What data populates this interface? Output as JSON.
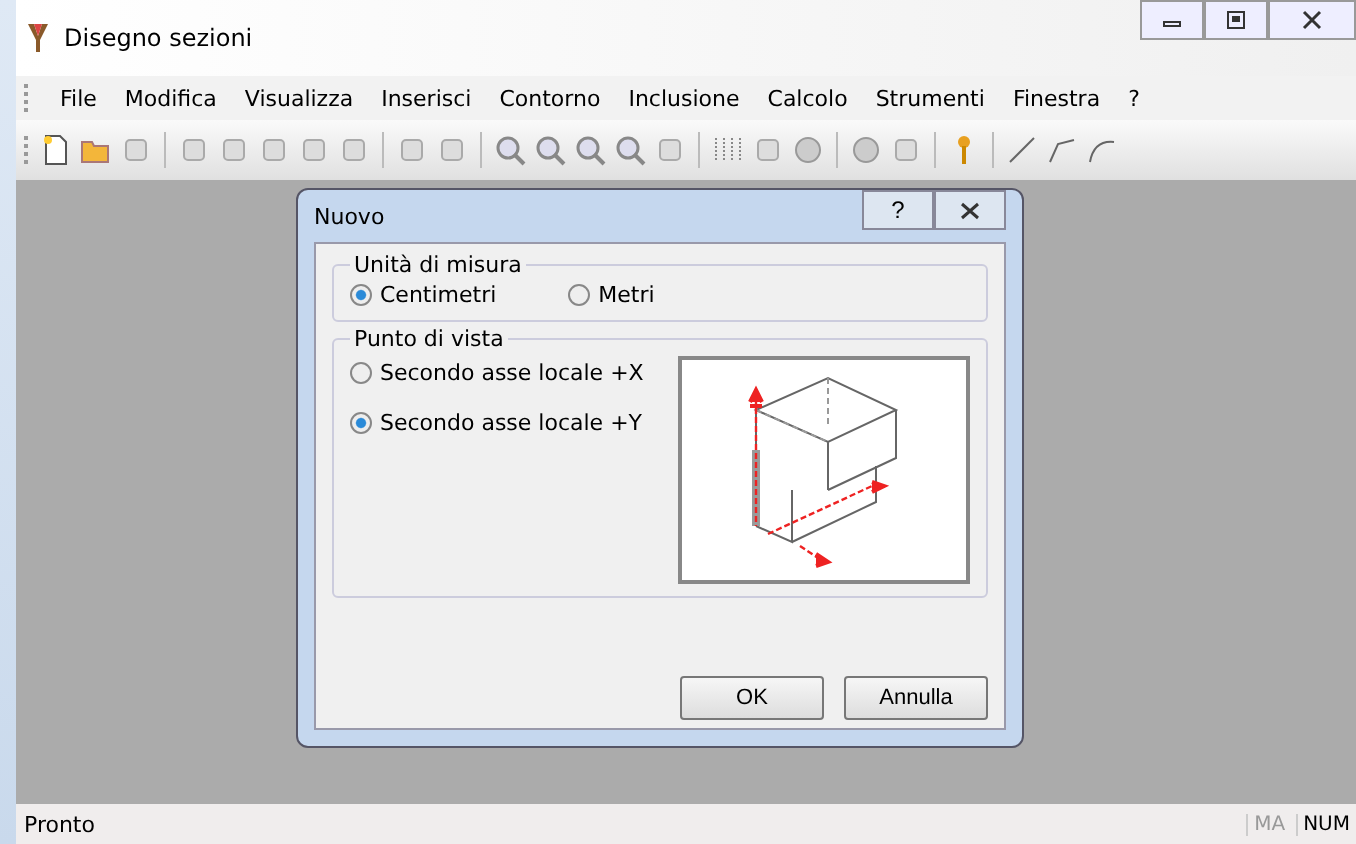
{
  "window": {
    "title": "Disegno sezioni"
  },
  "menu": [
    "File",
    "Modifica",
    "Visualizza",
    "Inserisci",
    "Contorno",
    "Inclusione",
    "Calcolo",
    "Strumenti",
    "Finestra",
    "?"
  ],
  "dialog": {
    "title": "Nuovo",
    "help": "?",
    "unit_group": {
      "title": "Unità di misura",
      "options": [
        {
          "label": "Centimetri",
          "selected": true
        },
        {
          "label": "Metri",
          "selected": false
        }
      ]
    },
    "view_group": {
      "title": "Punto di vista",
      "options": [
        {
          "label": "Secondo asse locale +X",
          "selected": false
        },
        {
          "label": "Secondo asse locale +Y",
          "selected": true
        }
      ]
    },
    "buttons": [
      "OK",
      "Annulla"
    ]
  },
  "status_bar": {
    "text": "Pronto",
    "indicators": [
      {
        "label": "MA",
        "on": false
      },
      {
        "label": "NUM",
        "on": true
      }
    ]
  }
}
